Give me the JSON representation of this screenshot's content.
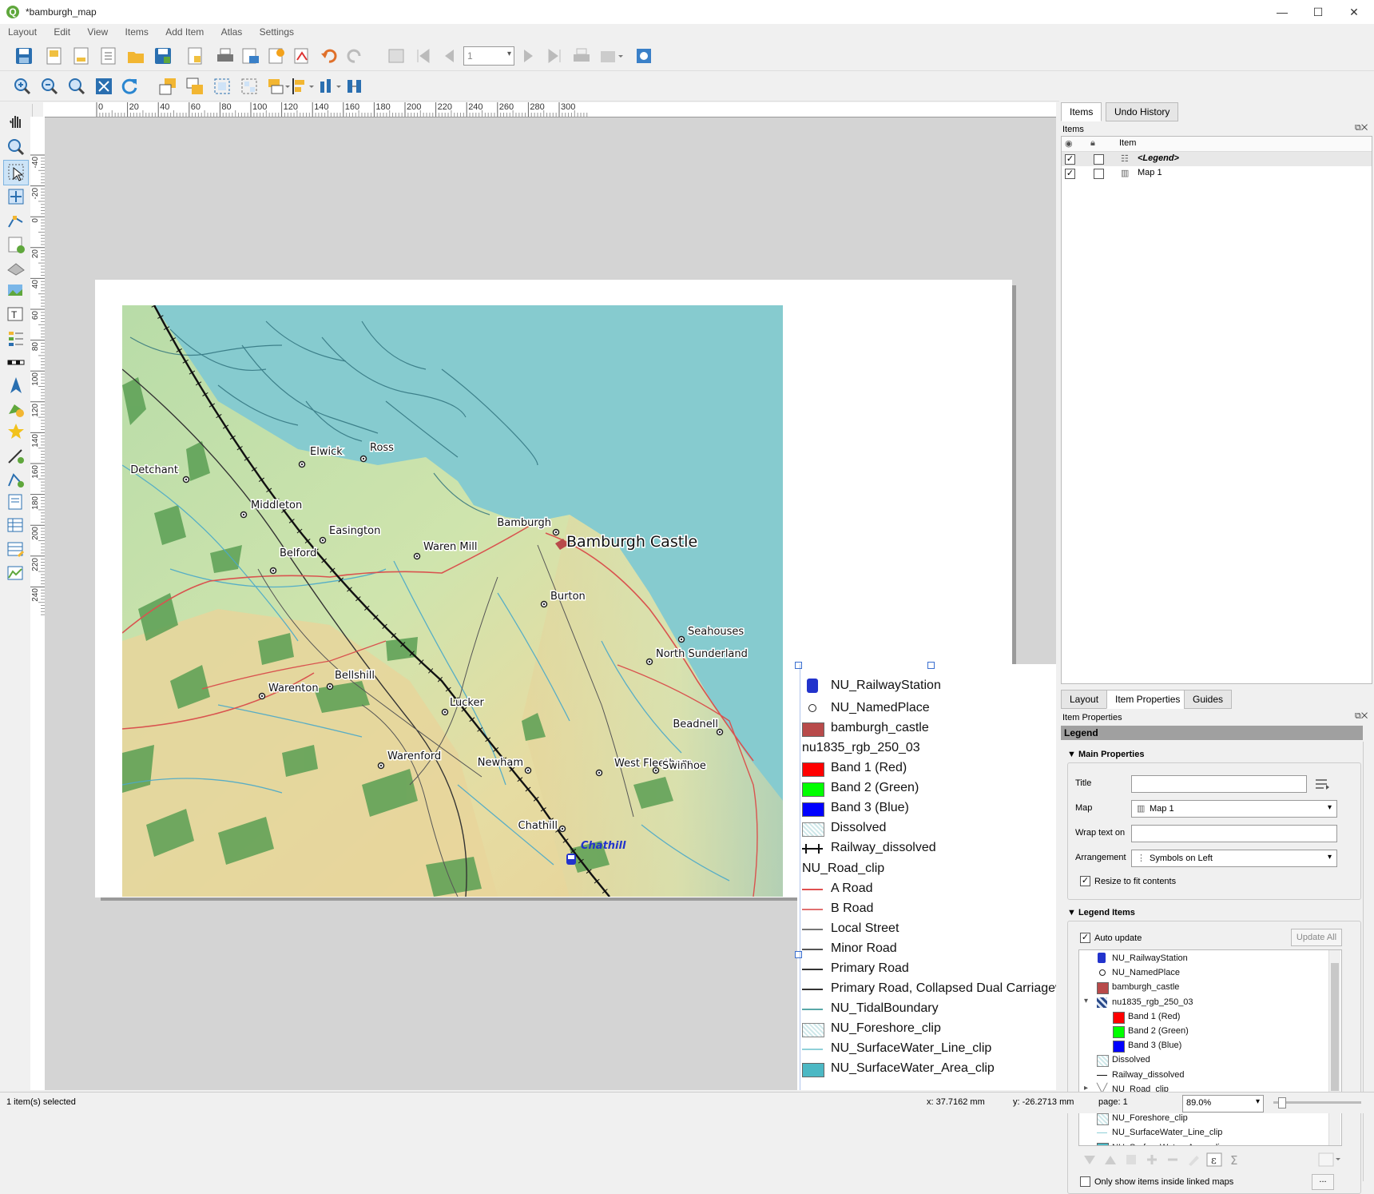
{
  "window": {
    "title": "*bamburgh_map",
    "logo": "Q",
    "minimize": "—",
    "maximize": "☐",
    "close": "✕"
  },
  "menu": [
    "Layout",
    "Edit",
    "View",
    "Items",
    "Add Item",
    "Atlas",
    "Settings"
  ],
  "atlas": {
    "page_value": "1"
  },
  "ruler": {
    "h_ticks": [
      "0",
      "20",
      "40",
      "60",
      "80",
      "100",
      "120",
      "140",
      "160",
      "180",
      "200",
      "220",
      "240",
      "260",
      "280",
      "300"
    ],
    "v_ticks": [
      "-40",
      "-20",
      "0",
      "20",
      "40",
      "60",
      "80",
      "100",
      "120",
      "140",
      "160",
      "180",
      "200",
      "220",
      "240"
    ]
  },
  "map": {
    "places": [
      {
        "name": "Detchant"
      },
      {
        "name": "Elwick"
      },
      {
        "name": "Ross"
      },
      {
        "name": "Middleton"
      },
      {
        "name": "Easington"
      },
      {
        "name": "Waren Mill"
      },
      {
        "name": "Bamburgh"
      },
      {
        "name": "Belford"
      },
      {
        "name": "Burton"
      },
      {
        "name": "Seahouses"
      },
      {
        "name": "North Sunderland"
      },
      {
        "name": "Bellshill"
      },
      {
        "name": "Warenton"
      },
      {
        "name": "Lucker"
      },
      {
        "name": "Beadnell"
      },
      {
        "name": "Warenford"
      },
      {
        "name": "Newham"
      },
      {
        "name": "West Fleetham"
      },
      {
        "name": "Swinhoe"
      },
      {
        "name": "Chathill"
      }
    ],
    "castle_label": "Bamburgh Castle",
    "station_label": "Chathill"
  },
  "legend": {
    "items": [
      {
        "label": "NU_RailwayStation",
        "kind": "station-icon"
      },
      {
        "label": "NU_NamedPlace",
        "kind": "point-icon"
      },
      {
        "label": "bamburgh_castle",
        "kind": "fill",
        "color": "#b84a4a"
      },
      {
        "label": "nu1835_rgb_250_03",
        "kind": "group"
      },
      {
        "label": "Band 1 (Red)",
        "kind": "fill",
        "color": "#ff0000"
      },
      {
        "label": "Band 2 (Green)",
        "kind": "fill",
        "color": "#00ff00"
      },
      {
        "label": "Band 3 (Blue)",
        "kind": "fill",
        "color": "#0000ff"
      },
      {
        "label": "Dissolved",
        "kind": "dotted"
      },
      {
        "label": "Railway_dissolved",
        "kind": "rail"
      },
      {
        "label": "NU_Road_clip",
        "kind": "group"
      },
      {
        "label": "A Road",
        "kind": "line",
        "color": "#e05050"
      },
      {
        "label": "B Road",
        "kind": "line",
        "color": "#e07070"
      },
      {
        "label": "Local Street",
        "kind": "line",
        "color": "#777777"
      },
      {
        "label": "Minor Road",
        "kind": "line",
        "color": "#555555"
      },
      {
        "label": "Primary Road",
        "kind": "line",
        "color": "#333333"
      },
      {
        "label": "Primary Road, Collapsed Dual Carriagew",
        "kind": "line",
        "color": "#333333"
      },
      {
        "label": "NU_TidalBoundary",
        "kind": "line",
        "color": "#5aa8a8"
      },
      {
        "label": "NU_Foreshore_clip",
        "kind": "dotted"
      },
      {
        "label": "NU_SurfaceWater_Line_clip",
        "kind": "line",
        "color": "#8fd0d8"
      },
      {
        "label": "NU_SurfaceWater_Area_clip",
        "kind": "fill",
        "color": "#4cb8c4"
      }
    ]
  },
  "right_panel": {
    "top_tabs": [
      "Items",
      "Undo History"
    ],
    "items_header": "Items",
    "items_column": "Item",
    "items": [
      {
        "name": "<Legend>",
        "visible": "✓"
      },
      {
        "name": "Map 1",
        "visible": "✓"
      }
    ],
    "bottom_tabs": [
      "Layout",
      "Item Properties",
      "Guides"
    ],
    "props_header": "Item Properties",
    "section_title": "Legend",
    "main_properties": "Main Properties",
    "title_label": "Title",
    "title_value": "",
    "map_label": "Map",
    "map_value": "Map 1",
    "wrap_label": "Wrap text on",
    "wrap_value": "",
    "arrangement_label": "Arrangement",
    "arrangement_value": "Symbols on Left",
    "resize_label": "Resize to fit contents",
    "resize_checked": "✓",
    "legend_items_title": "Legend Items",
    "auto_update_label": "Auto update",
    "auto_update_checked": "✓",
    "update_all": "Update All",
    "tree": [
      {
        "label": "NU_RailwayStation",
        "indent": 0,
        "kind": "station-icon"
      },
      {
        "label": "NU_NamedPlace",
        "indent": 0,
        "kind": "point-icon"
      },
      {
        "label": "bamburgh_castle",
        "indent": 0,
        "kind": "fill",
        "color": "#b84a4a"
      },
      {
        "label": "nu1835_rgb_250_03",
        "indent": 0,
        "kind": "raster",
        "expander": "▾"
      },
      {
        "label": "Band 1 (Red)",
        "indent": 1,
        "kind": "fill",
        "color": "#ff0000"
      },
      {
        "label": "Band 2 (Green)",
        "indent": 1,
        "kind": "fill",
        "color": "#00ff00"
      },
      {
        "label": "Band 3 (Blue)",
        "indent": 1,
        "kind": "fill",
        "color": "#0000ff"
      },
      {
        "label": "Dissolved",
        "indent": 0,
        "kind": "dotted"
      },
      {
        "label": "Railway_dissolved",
        "indent": 0,
        "kind": "rail"
      },
      {
        "label": "NU_Road_clip",
        "indent": 0,
        "kind": "lines",
        "expander": "▸"
      },
      {
        "label": "NU_TidalBoundary",
        "indent": 0,
        "kind": "line",
        "color": "#5aa8a8"
      },
      {
        "label": "NU_Foreshore_clip",
        "indent": 0,
        "kind": "dotted"
      },
      {
        "label": "NU_SurfaceWater_Line_clip",
        "indent": 0,
        "kind": "line",
        "color": "#8fd0d8"
      },
      {
        "label": "NU_SurfaceWater_Area_clip",
        "indent": 0,
        "kind": "fill",
        "color": "#4cb8c4"
      }
    ],
    "only_show_label": "Only show items inside linked maps",
    "more_button": "..."
  },
  "status": {
    "selected": "1 item(s) selected",
    "x": "x: 37.7162 mm",
    "y": "y: -26.2713 mm",
    "page": "page: 1",
    "zoom": "89.0%"
  }
}
